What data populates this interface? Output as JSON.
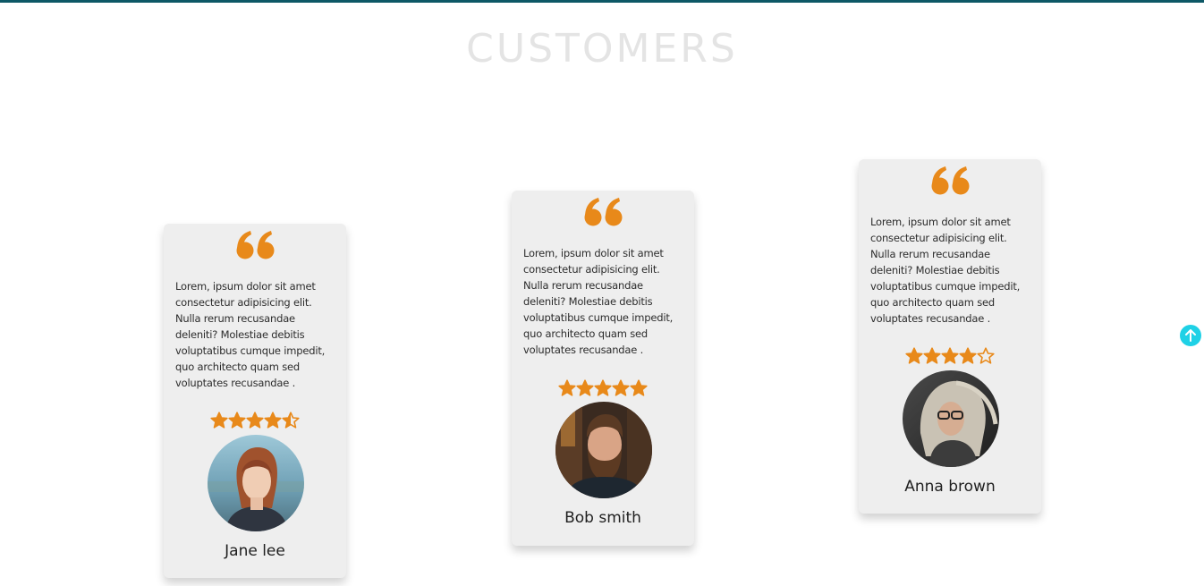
{
  "section": {
    "title": "CUSTOMERS"
  },
  "colors": {
    "accent": "#e8891a",
    "card_bg": "#eeeeee",
    "top_bar": "#0d5866",
    "scroll_button": "#1fd1e6",
    "title": "#e4e4e4"
  },
  "icons": {
    "quote": "quote-icon",
    "star": "star-icon",
    "scroll_top": "arrow-up-icon"
  },
  "testimonials": [
    {
      "text": "Lorem, ipsum dolor sit amet consectetur adipisicing elit. Nulla rerum recusandae deleniti? Molestiae debitis voluptatibus cumque impedit, quo architecto quam sed voluptates recusandae .",
      "rating": 4.5,
      "name": "Jane lee"
    },
    {
      "text": "Lorem, ipsum dolor sit amet consectetur adipisicing elit. Nulla rerum recusandae deleniti? Molestiae debitis voluptatibus cumque impedit, quo architecto quam sed voluptates recusandae .",
      "rating": 5,
      "name": "Bob smith"
    },
    {
      "text": "Lorem, ipsum dolor sit amet consectetur adipisicing elit. Nulla rerum recusandae deleniti? Molestiae debitis voluptatibus cumque impedit, quo architecto quam sed voluptates recusandae .",
      "rating": 4,
      "name": "Anna brown"
    }
  ]
}
